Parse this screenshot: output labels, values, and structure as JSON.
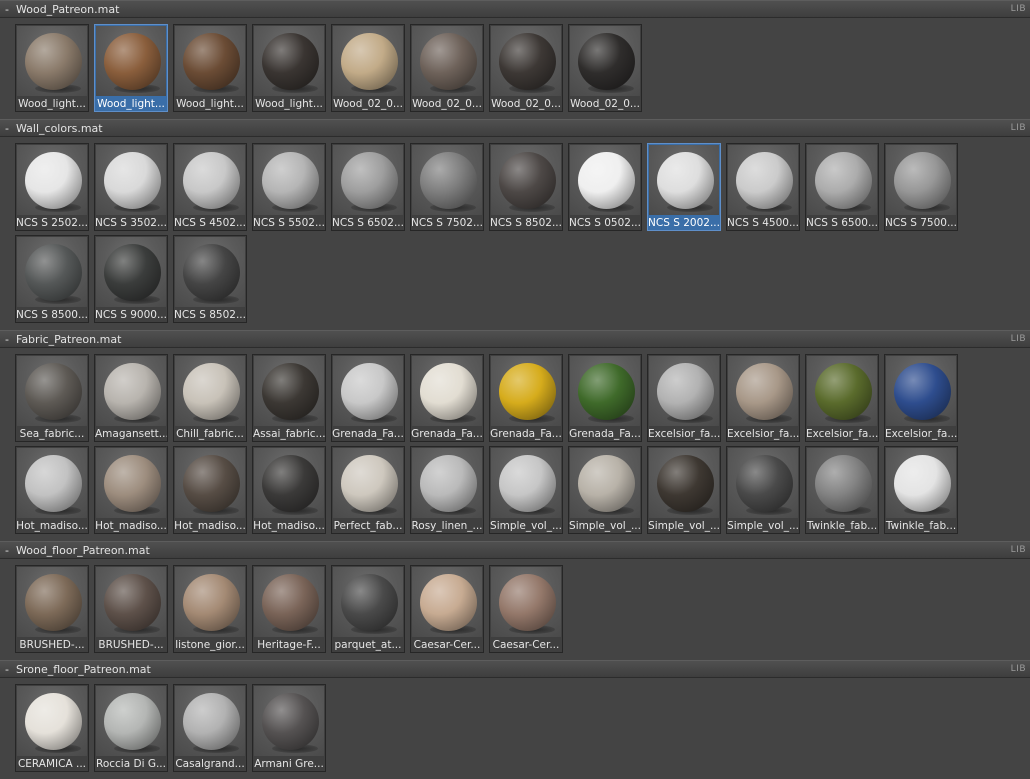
{
  "lib_label": "LIB",
  "toggle_glyph": "-",
  "sections": [
    {
      "title": "Wood_Patreon.mat",
      "items": [
        {
          "label": "Wood_light...",
          "color": "#8a7a6a"
        },
        {
          "label": "Wood_light...",
          "color": "#8a5e3c",
          "selected": true
        },
        {
          "label": "Wood_light...",
          "color": "#6b4c35"
        },
        {
          "label": "Wood_light...",
          "color": "#3a3532"
        },
        {
          "label": "Wood_02_0...",
          "color": "#c2ab88"
        },
        {
          "label": "Wood_02_0...",
          "color": "#6e625a"
        },
        {
          "label": "Wood_02_0...",
          "color": "#3d3835"
        },
        {
          "label": "Wood_02_0...",
          "color": "#2f2d2c"
        }
      ]
    },
    {
      "title": "Wall_colors.mat",
      "items": [
        {
          "label": "NCS S 2502...",
          "color": "#e6e6e6"
        },
        {
          "label": "NCS S 3502...",
          "color": "#d9d9d9"
        },
        {
          "label": "NCS S 4502...",
          "color": "#c8c8c8"
        },
        {
          "label": "NCS S 5502...",
          "color": "#b5b5b5"
        },
        {
          "label": "NCS S 6502...",
          "color": "#9e9e9e"
        },
        {
          "label": "NCS S 7502...",
          "color": "#7e7e7e"
        },
        {
          "label": "NCS S 8502...",
          "color": "#4d4846"
        },
        {
          "label": "NCS S 0502...",
          "color": "#efefef"
        },
        {
          "label": "NCS S 2002...",
          "color": "#dedede",
          "selected": true
        },
        {
          "label": "NCS S 4500...",
          "color": "#cbcbcb"
        },
        {
          "label": "NCS S 6500...",
          "color": "#acacac"
        },
        {
          "label": "NCS S 7500...",
          "color": "#979797"
        },
        {
          "label": "NCS S 8500...",
          "color": "#555858"
        },
        {
          "label": "NCS S 9000...",
          "color": "#3b3d3c"
        },
        {
          "label": "NCS S 8502...",
          "color": "#454545"
        }
      ]
    },
    {
      "title": "Fabric_Patreon.mat",
      "items": [
        {
          "label": "Sea_fabric...",
          "color": "#5e5a55"
        },
        {
          "label": "Amagansett...",
          "color": "#b8b4ae"
        },
        {
          "label": "Chill_fabric...",
          "color": "#c8c2b8"
        },
        {
          "label": "Assai_fabric...",
          "color": "#3c3834"
        },
        {
          "label": "Grenada_Fa...",
          "color": "#c8c8c8"
        },
        {
          "label": "Grenada_Fa...",
          "color": "#e2ddd2"
        },
        {
          "label": "Grenada_Fa...",
          "color": "#d6ac1c"
        },
        {
          "label": "Grenada_Fa...",
          "color": "#3f6a2a"
        },
        {
          "label": "Excelsior_fa...",
          "color": "#b2b2b2"
        },
        {
          "label": "Excelsior_fa...",
          "color": "#a89888"
        },
        {
          "label": "Excelsior_fa...",
          "color": "#5a6b2c"
        },
        {
          "label": "Excelsior_fa...",
          "color": "#2e4d8e"
        },
        {
          "label": "Hot_madiso...",
          "color": "#c2c2c2"
        },
        {
          "label": "Hot_madiso...",
          "color": "#9d8d7e"
        },
        {
          "label": "Hot_madiso...",
          "color": "#574d45"
        },
        {
          "label": "Hot_madiso...",
          "color": "#3b3a39"
        },
        {
          "label": "Perfect_fab...",
          "color": "#cec8be"
        },
        {
          "label": "Rosy_linen_...",
          "color": "#bababa"
        },
        {
          "label": "Simple_vol_...",
          "color": "#c6c6c6"
        },
        {
          "label": "Simple_vol_...",
          "color": "#b8b2a8"
        },
        {
          "label": "Simple_vol_...",
          "color": "#3e3832"
        },
        {
          "label": "Simple_vol_...",
          "color": "#4a4a4a"
        },
        {
          "label": "Twinkle_fab...",
          "color": "#838383"
        },
        {
          "label": "Twinkle_fab...",
          "color": "#e4e4e4"
        }
      ]
    },
    {
      "title": "Wood_floor_Patreon.mat",
      "items": [
        {
          "label": "BRUSHED-...",
          "color": "#7d6a58"
        },
        {
          "label": "BRUSHED-...",
          "color": "#5e514a"
        },
        {
          "label": "listone_gior...",
          "color": "#a48a74"
        },
        {
          "label": "Heritage-F...",
          "color": "#7a6458"
        },
        {
          "label": "parquet_at...",
          "color": "#4a4a4a"
        },
        {
          "label": "Caesar-Cer...",
          "color": "#c7ab92"
        },
        {
          "label": "Caesar-Cer...",
          "color": "#94786a"
        }
      ]
    },
    {
      "title": "Srone_floor_Patreon.mat",
      "items": [
        {
          "label": "CERAMICA ...",
          "color": "#e5e1da"
        },
        {
          "label": "Roccia Di G...",
          "color": "#b4b6b4"
        },
        {
          "label": "Casalgrand...",
          "color": "#b2b2b2"
        },
        {
          "label": "Armani Gre...",
          "color": "#555252"
        }
      ]
    }
  ]
}
